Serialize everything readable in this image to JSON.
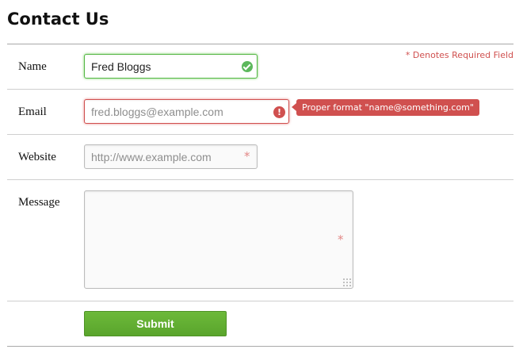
{
  "page": {
    "title": "Contact Us"
  },
  "form": {
    "required_note": "* Denotes Required Field",
    "name": {
      "label": "Name",
      "value": "Fred Bloggs",
      "state": "valid",
      "status_icon": "check-circle-icon"
    },
    "email": {
      "label": "Email",
      "value": "",
      "placeholder": "fred.bloggs@example.com",
      "state": "invalid",
      "status_icon": "error-circle-icon",
      "error_tooltip": "Proper format \"name@something.com\""
    },
    "website": {
      "label": "Website",
      "value": "",
      "placeholder": "http://www.example.com",
      "required_mark": "*"
    },
    "message": {
      "label": "Message",
      "value": "",
      "required_mark": "*"
    },
    "submit_label": "Submit"
  },
  "colors": {
    "valid": "#5cb85c",
    "error": "#d0504f",
    "submit": "#62ae33",
    "required_star": "#e38887"
  }
}
